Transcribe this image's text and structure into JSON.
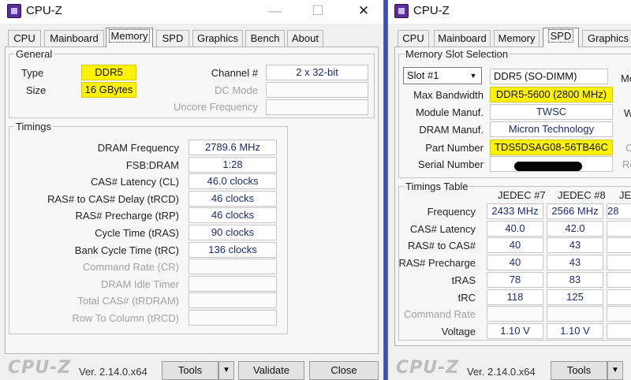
{
  "left": {
    "title": "CPU-Z",
    "controls": {
      "minimize": "—",
      "maximize": "☐",
      "close": "✕"
    },
    "tabs": [
      "CPU",
      "Mainboard",
      "Memory",
      "SPD",
      "Graphics",
      "Bench",
      "About"
    ],
    "active_tab": "Memory",
    "general": {
      "legend": "General",
      "type_label": "Type",
      "type_value": "DDR5",
      "size_label": "Size",
      "size_value": "16 GBytes",
      "channel_label": "Channel #",
      "channel_value": "2 x 32-bit",
      "dcmode_label": "DC Mode",
      "dcmode_value": "",
      "uncore_label": "Uncore Frequency",
      "uncore_value": ""
    },
    "timings": {
      "legend": "Timings",
      "rows": [
        {
          "label": "DRAM Frequency",
          "value": "2789.6 MHz",
          "enabled": true
        },
        {
          "label": "FSB:DRAM",
          "value": "1:28",
          "enabled": true
        },
        {
          "label": "CAS# Latency (CL)",
          "value": "46.0 clocks",
          "enabled": true
        },
        {
          "label": "RAS# to CAS# Delay (tRCD)",
          "value": "46 clocks",
          "enabled": true
        },
        {
          "label": "RAS# Precharge (tRP)",
          "value": "46 clocks",
          "enabled": true
        },
        {
          "label": "Cycle Time (tRAS)",
          "value": "90 clocks",
          "enabled": true
        },
        {
          "label": "Bank Cycle Time (tRC)",
          "value": "136 clocks",
          "enabled": true
        },
        {
          "label": "Command Rate (CR)",
          "value": "",
          "enabled": false
        },
        {
          "label": "DRAM Idle Timer",
          "value": "",
          "enabled": false
        },
        {
          "label": "Total CAS# (tRDRAM)",
          "value": "",
          "enabled": false
        },
        {
          "label": "Row To Column (tRCD)",
          "value": "",
          "enabled": false
        }
      ]
    },
    "footer": {
      "logo": "CPU-Z",
      "version": "Ver. 2.14.0.x64",
      "tools_label": "Tools",
      "dropdown_glyph": "▼",
      "validate_label": "Validate",
      "close_label": "Close"
    }
  },
  "right": {
    "title": "CPU-Z",
    "tabs": [
      "CPU",
      "Mainboard",
      "Memory",
      "SPD",
      "Graphics"
    ],
    "active_tab": "SPD",
    "slot": {
      "legend": "Memory Slot Selection",
      "slot_value": "Slot #1",
      "dropdown_glyph": "▼",
      "module_type": "DDR5 (SO-DIMM)",
      "right_edge_label_1": "Mo",
      "right_edge_label_2": "W",
      "right_edge_label_3": "C",
      "right_edge_label_4": "Re",
      "max_bandwidth_label": "Max Bandwidth",
      "max_bandwidth_value": "DDR5-5600 (2800 MHz)",
      "module_manuf_label": "Module Manuf.",
      "module_manuf_value": "TWSC",
      "dram_manuf_label": "DRAM Manuf.",
      "dram_manuf_value": "Micron Technology",
      "part_number_label": "Part Number",
      "part_number_value": "TDS5DSAG08-56TB46C",
      "serial_number_label": "Serial Number"
    },
    "timings_table": {
      "legend": "Timings Table",
      "columns": [
        "JEDEC #7",
        "JEDEC #8",
        "JE"
      ],
      "rows": [
        {
          "label": "Frequency",
          "values": [
            "2433 MHz",
            "2566 MHz",
            "28"
          ],
          "enabled": true
        },
        {
          "label": "CAS# Latency",
          "values": [
            "40.0",
            "42.0",
            ""
          ],
          "enabled": true
        },
        {
          "label": "RAS# to CAS#",
          "values": [
            "40",
            "43",
            ""
          ],
          "enabled": true
        },
        {
          "label": "RAS# Precharge",
          "values": [
            "40",
            "43",
            ""
          ],
          "enabled": true
        },
        {
          "label": "tRAS",
          "values": [
            "78",
            "83",
            ""
          ],
          "enabled": true
        },
        {
          "label": "tRC",
          "values": [
            "118",
            "125",
            ""
          ],
          "enabled": true
        },
        {
          "label": "Command Rate",
          "values": [
            "",
            "",
            ""
          ],
          "enabled": false
        },
        {
          "label": "Voltage",
          "values": [
            "1.10 V",
            "1.10 V",
            ""
          ],
          "enabled": true
        }
      ]
    },
    "footer": {
      "logo": "CPU-Z",
      "version": "Ver. 2.14.0.x64",
      "tools_label": "Tools",
      "dropdown_glyph": "▼"
    }
  },
  "colors": {
    "highlight": "#fff200",
    "value_text": "#1b2a7a",
    "disabled_text": "#a2a2a2",
    "window_border": "#3a4fb8",
    "app_icon": "#5b2d9a"
  },
  "icons": {
    "app": "cpu-z-app-icon"
  }
}
